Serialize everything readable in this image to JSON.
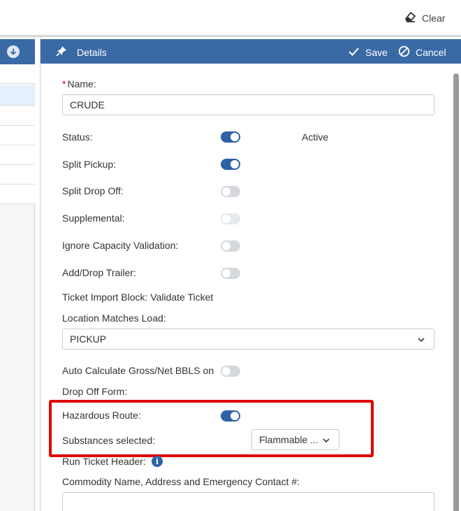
{
  "topbar": {
    "clear_label": "Clear"
  },
  "details": {
    "title": "Details",
    "save_label": "Save",
    "cancel_label": "Cancel"
  },
  "form": {
    "required_mark": "*",
    "name_label": "Name:",
    "name_value": "CRUDE",
    "status_label": "Status:",
    "status_on": true,
    "status_text": "Active",
    "split_pickup_label": "Split Pickup:",
    "split_pickup_on": true,
    "split_dropoff_label": "Split Drop Off:",
    "split_dropoff_on": false,
    "supplemental_label": "Supplemental:",
    "supplemental_on": false,
    "ignore_capacity_label": "Ignore Capacity Validation:",
    "ignore_capacity_on": false,
    "add_drop_trailer_label": "Add/Drop Trailer:",
    "add_drop_trailer_on": false,
    "ticket_import_label": "Ticket Import Block: Validate Ticket",
    "location_matches_label": "Location Matches Load:",
    "location_matches_value": "PICKUP",
    "auto_calc_label": "Auto Calculate Gross/Net BBLS on",
    "auto_calc_on": false,
    "drop_off_form_label": "Drop Off Form:",
    "hazardous_route_label": "Hazardous Route:",
    "hazardous_route_on": true,
    "substances_label": "Substances selected:",
    "substances_value": "Flammable ...",
    "run_ticket_header_label": "Run Ticket Header:",
    "commodity_label": "Commodity Name, Address and Emergency Contact #:",
    "commodity_value": ""
  },
  "colors": {
    "header_blue": "#3a6aa6",
    "toggle_on": "#2e62a6",
    "highlight_red": "#e00000"
  }
}
